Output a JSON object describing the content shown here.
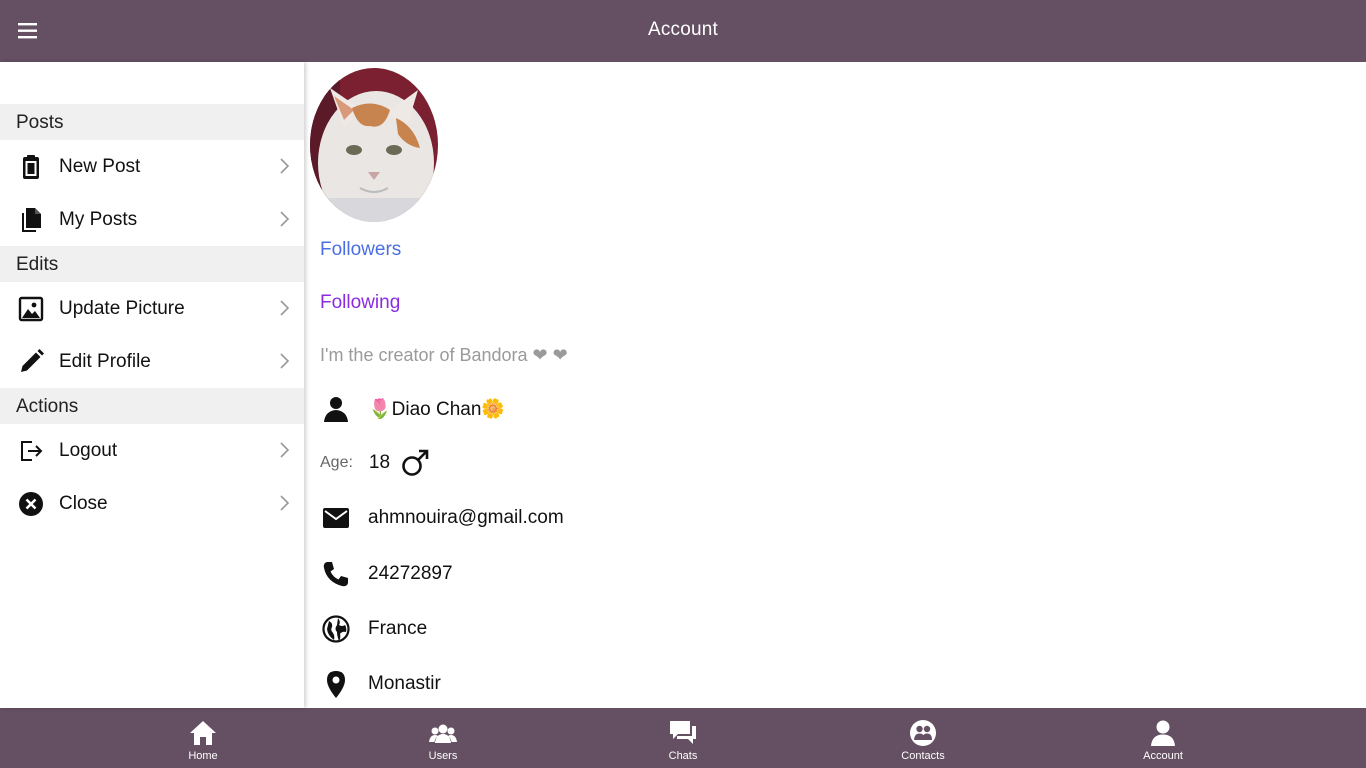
{
  "header": {
    "title": "Account"
  },
  "sidebar": {
    "sections": [
      {
        "title": "Posts",
        "items": [
          {
            "label": "New Post"
          },
          {
            "label": "My Posts"
          }
        ]
      },
      {
        "title": "Edits",
        "items": [
          {
            "label": "Update Picture"
          },
          {
            "label": "Edit Profile"
          }
        ]
      },
      {
        "title": "Actions",
        "items": [
          {
            "label": "Logout"
          },
          {
            "label": "Close"
          }
        ]
      }
    ]
  },
  "profile": {
    "followers_label": "Followers",
    "following_label": "Following",
    "bio": "I'm the creator of Bandora ❤ ❤",
    "name": "🌷Diao Chan🌼",
    "age_label": "Age:",
    "age": "18",
    "email": "ahmnouira@gmail.com",
    "phone": "24272897",
    "country": "France",
    "city": "Monastir"
  },
  "tabs": [
    {
      "label": "Home",
      "icon": "home-icon"
    },
    {
      "label": "Users",
      "icon": "users-icon"
    },
    {
      "label": "Chats",
      "icon": "chats-icon"
    },
    {
      "label": "Contacts",
      "icon": "contacts-icon"
    },
    {
      "label": "Account",
      "icon": "account-icon"
    }
  ],
  "colors": {
    "bar": "#645062",
    "followers": "#4a6fe3",
    "following": "#8a2be2"
  }
}
